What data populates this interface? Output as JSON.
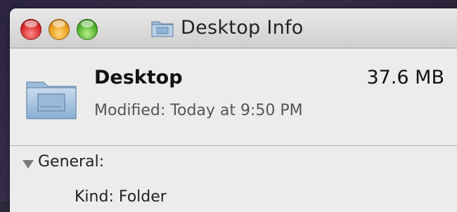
{
  "window": {
    "title": "Desktop Info",
    "controls": {
      "close": "close-button",
      "minimize": "minimize-button",
      "zoom": "zoom-button"
    },
    "title_icon": "folder-icon"
  },
  "header": {
    "name": "Desktop",
    "size": "37.6 MB",
    "modified": "Modified: Today at 9:50 PM",
    "icon": "folder-icon"
  },
  "general": {
    "title": "General:",
    "kind": "Kind: Folder"
  },
  "colors": {
    "close": "#d62a2a",
    "minimize": "#e89a1a",
    "zoom": "#4fae2a",
    "folder": "#8fb3d6"
  }
}
